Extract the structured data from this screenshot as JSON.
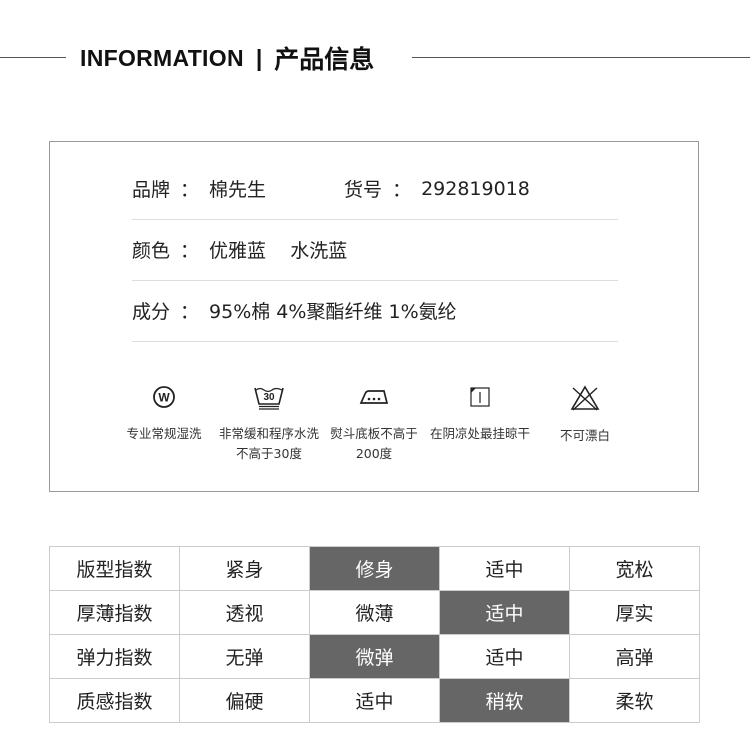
{
  "header": {
    "en": "INFORMATION",
    "sep": "|",
    "cn": "产品信息"
  },
  "info": {
    "brand_label": "品牌",
    "brand_value": "棉先生",
    "sku_label": "货号",
    "sku_value": "292819018",
    "color_label": "颜色",
    "color_value": "优雅蓝    水洗蓝",
    "material_label": "成分",
    "material_value": "95%棉 4%聚酯纤维 1%氨纶",
    "colon": "："
  },
  "care": [
    {
      "icon": "professional-wet-clean-icon",
      "caption": "专业常规湿洗"
    },
    {
      "icon": "gentle-wash-30-icon",
      "caption": "非常缓和程序水洗不高于30度"
    },
    {
      "icon": "iron-200-icon",
      "caption": "熨斗底板不高于200度"
    },
    {
      "icon": "shade-line-dry-icon",
      "caption": "在阴凉处最挂晾干"
    },
    {
      "icon": "do-not-bleach-icon",
      "caption": "不可漂白"
    }
  ],
  "index_table": {
    "highlight_color": "#666666",
    "rows": [
      {
        "label": "版型指数",
        "options": [
          "紧身",
          "修身",
          "适中",
          "宽松"
        ],
        "selected": 1
      },
      {
        "label": "厚薄指数",
        "options": [
          "透视",
          "微薄",
          "适中",
          "厚实"
        ],
        "selected": 2
      },
      {
        "label": "弹力指数",
        "options": [
          "无弹",
          "微弹",
          "适中",
          "高弹"
        ],
        "selected": 1
      },
      {
        "label": "质感指数",
        "options": [
          "偏硬",
          "适中",
          "稍软",
          "柔软"
        ],
        "selected": 2
      }
    ]
  }
}
